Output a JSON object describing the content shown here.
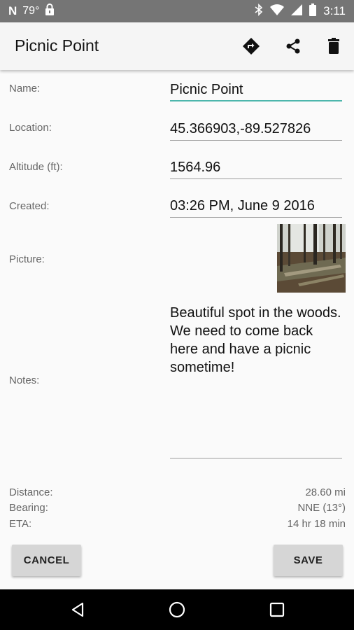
{
  "status_bar": {
    "temperature": "79°",
    "time": "3:11",
    "left_icons": [
      "n-logo-icon",
      "lock-icon"
    ],
    "right_icons": [
      "bluetooth-icon",
      "wifi-icon",
      "signal-icon",
      "battery-icon"
    ]
  },
  "app_bar": {
    "title": "Picnic Point",
    "actions": [
      "directions-icon",
      "share-icon",
      "delete-icon"
    ]
  },
  "form": {
    "name": {
      "label": "Name:",
      "value": "Picnic Point"
    },
    "location": {
      "label": "Location:",
      "value": "45.366903,-89.527826"
    },
    "altitude": {
      "label": "Altitude (ft):",
      "value": "1564.96"
    },
    "created": {
      "label": "Created:",
      "value": "03:26 PM, June 9 2016"
    },
    "picture": {
      "label": "Picture:"
    },
    "notes": {
      "label": "Notes:",
      "value": "Beautiful spot in the woods.  We need to come back here and have a picnic sometime!"
    }
  },
  "stats": {
    "distance": {
      "label": "Distance:",
      "value": "28.60 mi"
    },
    "bearing": {
      "label": "Bearing:",
      "value": "NNE (13°)"
    },
    "eta": {
      "label": "ETA:",
      "value": "14 hr 18 min"
    }
  },
  "buttons": {
    "cancel": "CANCEL",
    "save": "SAVE"
  },
  "nav_bar": [
    "back-icon",
    "home-icon",
    "recents-icon"
  ],
  "colors": {
    "status_bar": "#757575",
    "app_bar": "#f5f5f5",
    "accent": "#4db6ac",
    "button": "#d6d6d6"
  }
}
